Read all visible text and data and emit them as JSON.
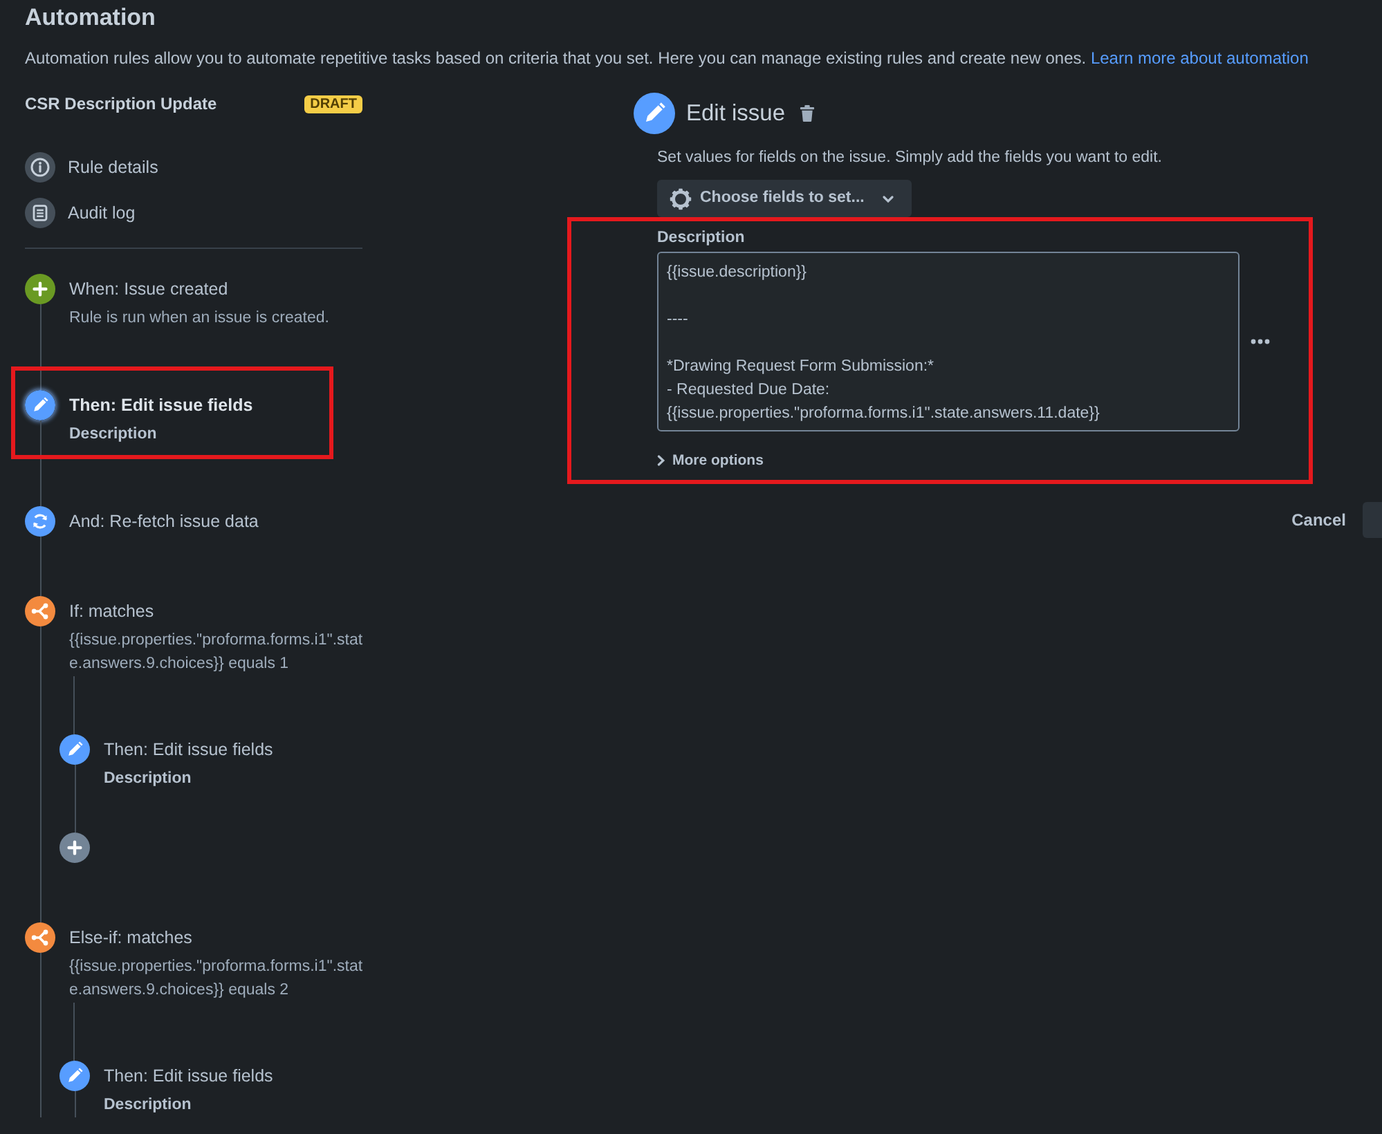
{
  "page": {
    "title": "Automation",
    "intro": "Automation rules allow you to automate repetitive tasks based on criteria that you set. Here you can manage existing rules and create new ones.",
    "intro_link": "Learn more about automation"
  },
  "rule": {
    "name": "CSR Description Update",
    "badge": "DRAFT"
  },
  "rule_menu": [
    {
      "kind": "details",
      "label": "Rule details"
    },
    {
      "kind": "audit",
      "label": "Audit log"
    }
  ],
  "steps": [
    {
      "kind": "trigger",
      "title": "When: Issue created",
      "subtitle": "Rule is run when an issue is created.",
      "selected": false,
      "highlighted": false
    },
    {
      "kind": "edit",
      "title": "Then: Edit issue fields",
      "subtitle": "Description",
      "selected": true,
      "highlighted": true
    },
    {
      "kind": "refetch",
      "title": "And: Re-fetch issue data",
      "selected": false,
      "highlighted": false
    },
    {
      "kind": "condition",
      "title": "If: matches",
      "subtitle": "{{issue.properties.\"proforma.forms.i1\".state.answers.9.choices}} equals 1",
      "selected": false,
      "highlighted": false,
      "children": [
        {
          "kind": "edit",
          "title": "Then: Edit issue fields",
          "subtitle": "Description",
          "selected": false,
          "highlighted": false
        },
        {
          "kind": "add",
          "selected": false,
          "highlighted": false
        }
      ]
    },
    {
      "kind": "condition",
      "title": "Else-if: matches",
      "subtitle": "{{issue.properties.\"proforma.forms.i1\".state.answers.9.choices}} equals 2",
      "selected": false,
      "highlighted": false,
      "children": [
        {
          "kind": "edit",
          "title": "Then: Edit issue fields",
          "subtitle": "Description",
          "selected": false,
          "highlighted": false
        }
      ]
    }
  ],
  "editor": {
    "title": "Edit issue",
    "hint": "Set values for fields on the issue. Simply add the fields you want to edit.",
    "choose_button": "Choose fields to set...",
    "field": {
      "label": "Description",
      "value": "{{issue.description}}\n\n----\n\n*Drawing Request Form Submission:*\n- Requested Due Date:\n{{issue.properties.\"proforma.forms.i1\".state.answers.11.date}}",
      "highlighted": true
    },
    "more_options": "More options",
    "actions": [
      {
        "kind": "subtle",
        "label": "Cancel"
      },
      {
        "kind": "cut"
      }
    ]
  }
}
